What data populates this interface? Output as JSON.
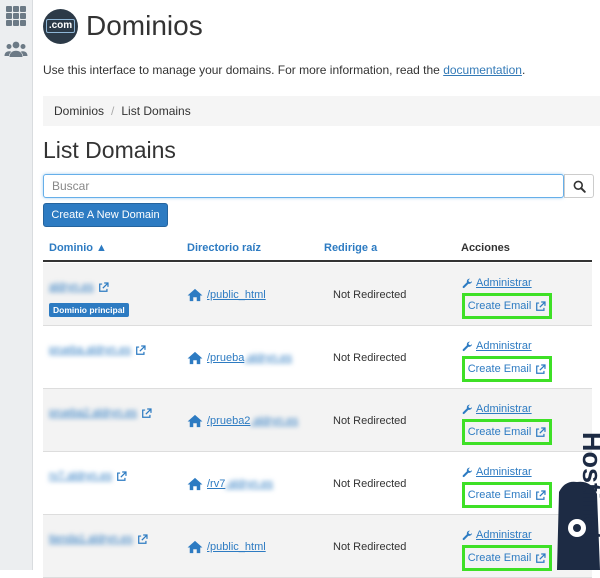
{
  "header": {
    "logo_text": ".com",
    "title": "Dominios"
  },
  "intro": {
    "text": "Use this interface to manage your domains. For more information, read the",
    "link_text": "documentation",
    "trailing": "."
  },
  "breadcrumb": {
    "items": [
      "Dominios",
      "List Domains"
    ],
    "separator": "/"
  },
  "section_title": "List Domains",
  "search": {
    "placeholder": "Buscar"
  },
  "create_button_label": "Create A New Domain",
  "table": {
    "headers": {
      "domain": "Dominio ▲",
      "docroot": "Directorio raíz",
      "redirect": "Redirige a",
      "actions": "Acciones"
    },
    "main_badge": "Dominio principal",
    "admin_label": "Administrar",
    "email_label": "Create Email",
    "rows": [
      {
        "domain": "aldryn.es",
        "docroot_prefix": "/public_html",
        "docroot_suffix": "",
        "redirect": "Not Redirected",
        "primary": true
      },
      {
        "domain": "prueba.aldryn.es",
        "docroot_prefix": "/prueba",
        "docroot_suffix": ".aldryn.es",
        "redirect": "Not Redirected",
        "primary": false
      },
      {
        "domain": "prueba2.aldryn.es",
        "docroot_prefix": "/prueba2",
        "docroot_suffix": ".aldryn.es",
        "redirect": "Not Redirected",
        "primary": false
      },
      {
        "domain": "rv7.aldryn.es",
        "docroot_prefix": "/rv7",
        "docroot_suffix": ".aldryn.es",
        "redirect": "Not Redirected",
        "primary": false
      },
      {
        "domain": "tienda1.aldryn.es",
        "docroot_prefix": "/public_html",
        "docroot_suffix": "",
        "redirect": "Not Redirected",
        "primary": false
      }
    ]
  },
  "watermark": {
    "text": "Hostinet"
  },
  "icons": {
    "sidebar": [
      "grid-icon",
      "users-icon"
    ],
    "row": [
      "external-link-icon",
      "home-icon",
      "wrench-icon"
    ],
    "search": "search-icon"
  },
  "colors": {
    "accent": "#2d7bc2",
    "highlight": "#3ee026",
    "logo_bg": "#2c3a48",
    "watermark": "#1d2b44"
  }
}
